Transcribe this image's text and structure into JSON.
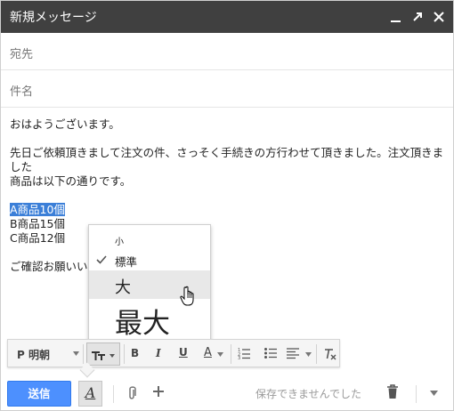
{
  "window": {
    "title": "新規メッセージ",
    "minimize_icon": "minimize-icon",
    "popout_icon": "popout-icon",
    "close_icon": "close-icon"
  },
  "compose": {
    "to_placeholder": "宛先",
    "subject_placeholder": "件名",
    "body": {
      "greeting": "おはようございます。",
      "paragraph_line1": "先日ご依頼頂きまして注文の件、さっそく手続きの方行わせて頂きました。注文頂きました",
      "paragraph_line2": "商品は以下の通りです。",
      "items": [
        "A商品10個",
        "B商品15個",
        "C商品12個"
      ],
      "closing_partial": "ご確認お願いい"
    }
  },
  "font_size_menu": {
    "items": [
      {
        "label": "小",
        "selected": false
      },
      {
        "label": "標準",
        "selected": true
      },
      {
        "label": "大",
        "selected": false,
        "hovered": true
      },
      {
        "label": "最大",
        "selected": false
      }
    ]
  },
  "format_toolbar": {
    "font_name": "P 明朝",
    "font_size_icon": "text-size-icon",
    "bold_label": "B",
    "italic_label": "I",
    "underline_label": "U",
    "text_color_label": "A",
    "numbered_list_icon": "numbered-list-icon",
    "bulleted_list_icon": "bulleted-list-icon",
    "align_icon": "align-icon",
    "remove_format_icon": "remove-formatting-icon"
  },
  "bottom_bar": {
    "send_label": "送信",
    "format_toggle_label": "A",
    "attach_icon": "paperclip-icon",
    "insert_icon": "plus-icon",
    "save_status": "保存できませんでした",
    "trash_icon": "trash-icon",
    "more_icon": "chevron-down-icon"
  },
  "colors": {
    "titlebar": "#404040",
    "send_button": "#4d90fe",
    "selection": "#3b7fd8"
  }
}
